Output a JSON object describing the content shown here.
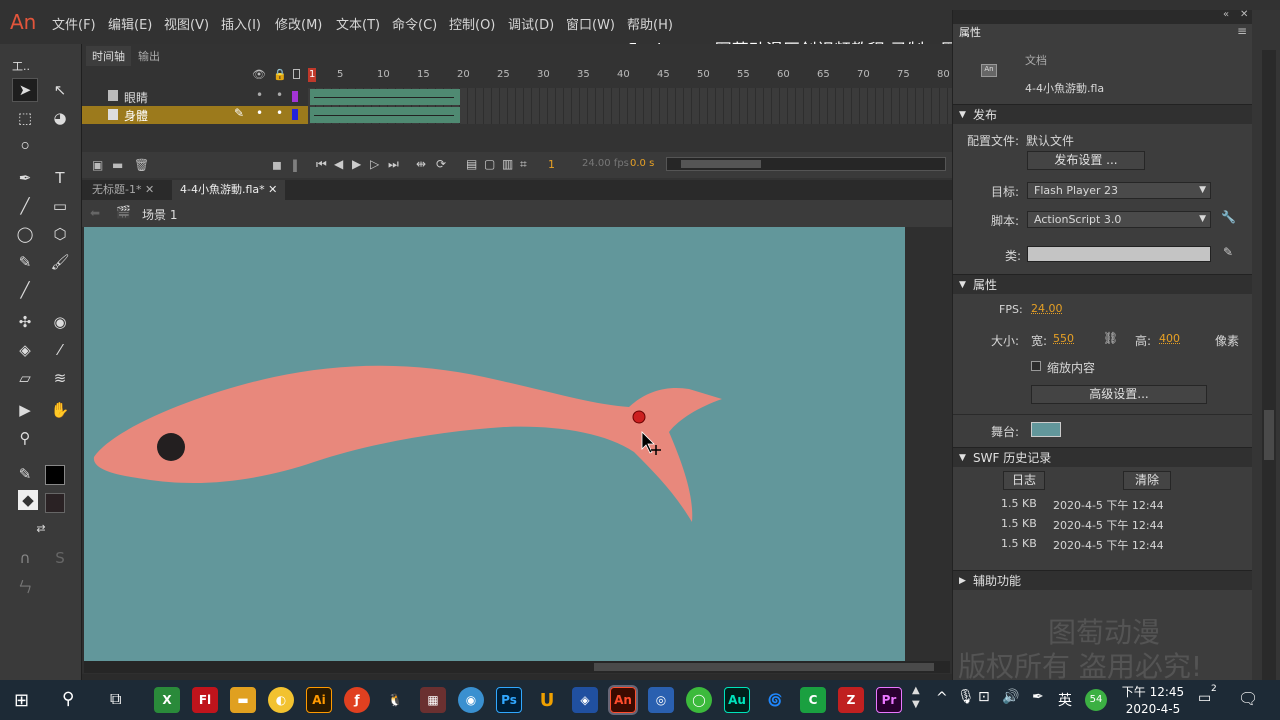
{
  "app": {
    "logo": "An"
  },
  "menu": [
    {
      "label": "文件(F)"
    },
    {
      "label": "编辑(E)"
    },
    {
      "label": "视图(V)"
    },
    {
      "label": "插入(I)"
    },
    {
      "label": "修改(M)"
    },
    {
      "label": "文本(T)"
    },
    {
      "label": "命令(C)"
    },
    {
      "label": "控制(O)"
    },
    {
      "label": "调试(D)"
    },
    {
      "label": "窗口(W)"
    },
    {
      "label": "帮助(H)"
    }
  ],
  "watermark_top": "www.xueflash.com  图萄动漫原创视频教程  录制：图萄老师  微信：xueflash",
  "toolbar": {
    "title": "工.."
  },
  "timeline": {
    "tabs": [
      {
        "label": "时间轴"
      },
      {
        "label": "输出"
      }
    ],
    "ruler": [
      "1",
      "5",
      "10",
      "15",
      "20",
      "25",
      "30",
      "35",
      "40",
      "45",
      "50",
      "55",
      "60",
      "65",
      "70",
      "75",
      "80"
    ],
    "layers": [
      {
        "name": "眼睛"
      },
      {
        "name": "身體"
      }
    ],
    "current_frame": "1",
    "fps": "24.00 fps",
    "time": "0.0 s"
  },
  "doc_tabs": [
    {
      "label": "无标题-1*"
    },
    {
      "label": "4-4小魚游動.fla*"
    }
  ],
  "scene": "场景 1",
  "props": {
    "panel_title": "属性",
    "doc_label": "文档",
    "doc_name": "4-4小魚游動.fla",
    "publish": {
      "header": "发布",
      "profile_label": "配置文件:",
      "profile_value": "默认文件",
      "settings_button": "发布设置 ...",
      "target_label": "目标:",
      "target_value": "Flash Player 23",
      "script_label": "脚本:",
      "script_value": "ActionScript 3.0",
      "class_label": "类:"
    },
    "properties": {
      "header": "属性",
      "fps_label": "FPS:",
      "fps_value": "24.00",
      "size_label": "大小:",
      "width_label": "宽:",
      "width_value": "550",
      "height_label": "高:",
      "height_value": "400",
      "unit": "像素",
      "scale_label": "缩放内容",
      "advanced_button": "高级设置...",
      "stage_label": "舞台:",
      "stage_color": "#62979b"
    },
    "swf_history": {
      "header": "SWF 历史记录",
      "log_button": "日志",
      "clear_button": "清除",
      "rows": [
        {
          "size": "1.5 KB",
          "time": "2020-4-5 下午 12:44"
        },
        {
          "size": "1.5 KB",
          "time": "2020-4-5 下午 12:44"
        },
        {
          "size": "1.5 KB",
          "time": "2020-4-5 下午 12:44"
        }
      ]
    },
    "accessibility_header": "辅助功能"
  },
  "watermark_bottom": [
    "图萄动漫",
    "版权所有 盗用必究!"
  ],
  "taskbar": {
    "apps": [
      {
        "name": "ai-icon",
        "label": "Ai",
        "color": "#ff9a00"
      },
      {
        "name": "ps-icon",
        "label": "Ps",
        "color": "#31a8ff"
      },
      {
        "name": "au-icon",
        "label": "Au",
        "color": "#00e4bb"
      },
      {
        "name": "pr-icon",
        "label": "Pr",
        "color": "#ea77ff"
      },
      {
        "name": "animate-icon",
        "label": "An",
        "color": "#ff4c2c"
      },
      {
        "name": "flash-icon",
        "label": "Fl",
        "color": "#e23b26"
      }
    ],
    "ime": "英",
    "badge": "54",
    "clock_time": "下午 12:45",
    "clock_date": "2020-4-5",
    "notif_count": "2"
  },
  "colors": {
    "stage": "#62979b",
    "fish": "#e8887c",
    "eye": "#231f20",
    "anchor": "#cc2020",
    "layer_highlight": "#9c7a1c"
  }
}
